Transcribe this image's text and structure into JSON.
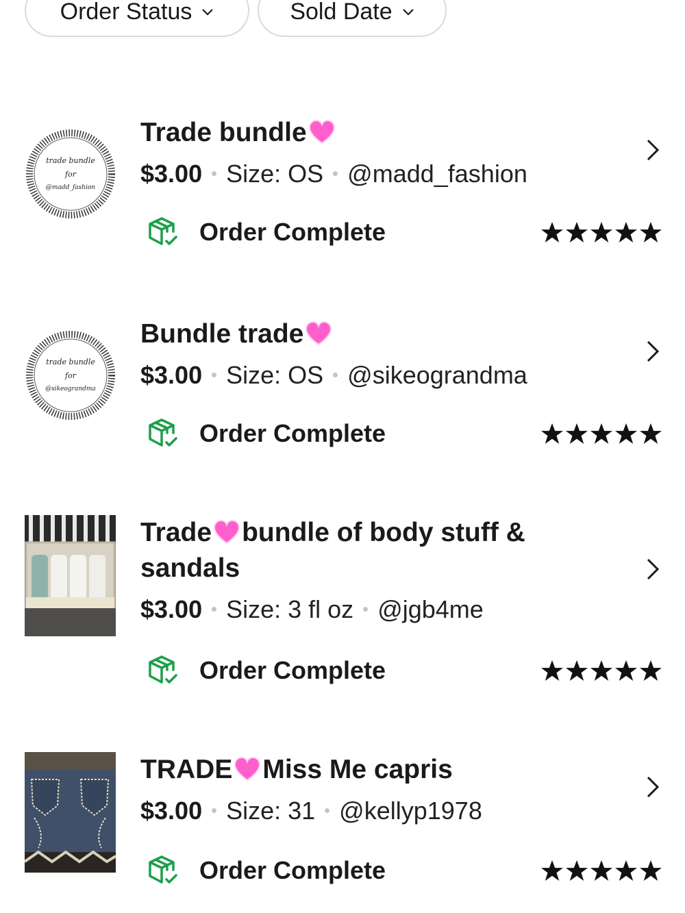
{
  "filters": [
    {
      "label": "Order Status"
    },
    {
      "label": "Sold Date"
    }
  ],
  "orders": [
    {
      "title_parts": [
        "Trade bundle",
        ""
      ],
      "price": "$3.00",
      "size": "Size: OS",
      "user": "@madd_fashion",
      "status": "Order Complete",
      "rating": 5,
      "thumb_text": [
        "trade bundle",
        "for",
        "@madd_fashion"
      ]
    },
    {
      "title_parts": [
        "Bundle trade",
        ""
      ],
      "price": "$3.00",
      "size": "Size: OS",
      "user": "@sikeograndma",
      "status": "Order Complete",
      "rating": 5,
      "thumb_text": [
        "trade bundle",
        "for",
        "@sikeograndma"
      ]
    },
    {
      "title_parts": [
        "Trade",
        "bundle of body stuff &",
        "sandals"
      ],
      "price": "$3.00",
      "size": "Size: 3 fl oz",
      "user": "@jgb4me",
      "status": "Order Complete",
      "rating": 5
    },
    {
      "title_parts": [
        "TRADE",
        "Miss Me capris"
      ],
      "price": "$3.00",
      "size": "Size: 31",
      "user": "@kellyp1978",
      "status": "Order Complete",
      "rating": 5
    }
  ],
  "colors": {
    "status_icon": "#1e9e4c",
    "heart": "#ff4fc9",
    "text": "#1a1a1a"
  },
  "icons": {
    "filter_chevron": "chevron-down-icon",
    "row_chevron": "chevron-right-icon",
    "status": "package-check-icon",
    "rating": "star-icon",
    "title_emoji": "pink-heart-icon"
  }
}
